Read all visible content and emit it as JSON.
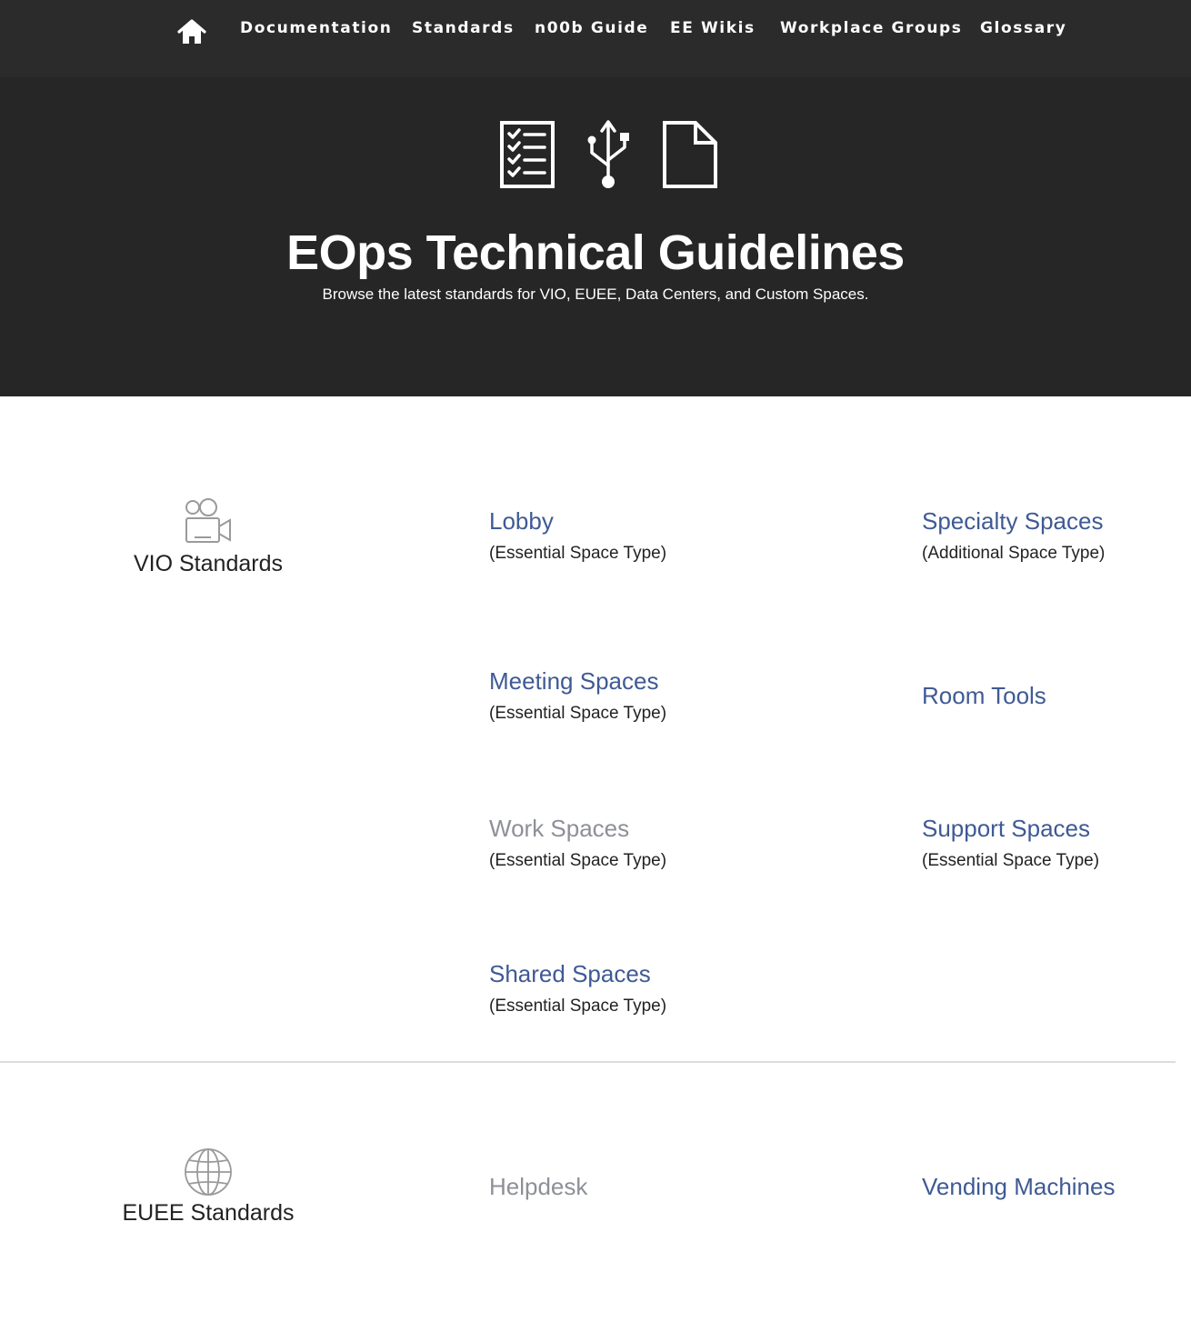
{
  "nav": {
    "home_icon": "home-icon",
    "items": [
      "Documentation",
      "Standards",
      "n00b Guide",
      "EE Wikis",
      "Workplace Groups",
      "Glossary"
    ]
  },
  "hero": {
    "icons": [
      "checklist-icon",
      "usb-icon",
      "document-icon"
    ],
    "title": "EOps Technical Guidelines",
    "subtitle": "Browse the latest standards for VIO, EUEE, Data Centers, and Custom Spaces."
  },
  "sections": {
    "vio": {
      "icon": "video-camera-icon",
      "label": "VIO Standards",
      "items": [
        {
          "title": "Lobby",
          "subtitle": "(Essential Space Type)"
        },
        {
          "title": "Specialty Spaces",
          "subtitle": "(Additional Space Type)"
        },
        {
          "title": "Meeting Spaces",
          "subtitle": "(Essential Space Type)"
        },
        {
          "title": "Room Tools",
          "subtitle": ""
        },
        {
          "title": "Work Spaces",
          "subtitle": "(Essential Space Type)"
        },
        {
          "title": "Support Spaces",
          "subtitle": "(Essential Space Type)"
        },
        {
          "title": "Shared Spaces",
          "subtitle": "(Essential Space Type)"
        }
      ]
    },
    "euee": {
      "icon": "globe-icon",
      "label": "EUEE Standards",
      "items": [
        {
          "title": "Helpdesk",
          "subtitle": ""
        },
        {
          "title": "Vending Machines",
          "subtitle": ""
        }
      ]
    }
  },
  "colors": {
    "nav_bg": "#2b2b2b",
    "hero_bg": "#262626",
    "link": "#3f5a94",
    "link_disabled": "#8e9097"
  }
}
